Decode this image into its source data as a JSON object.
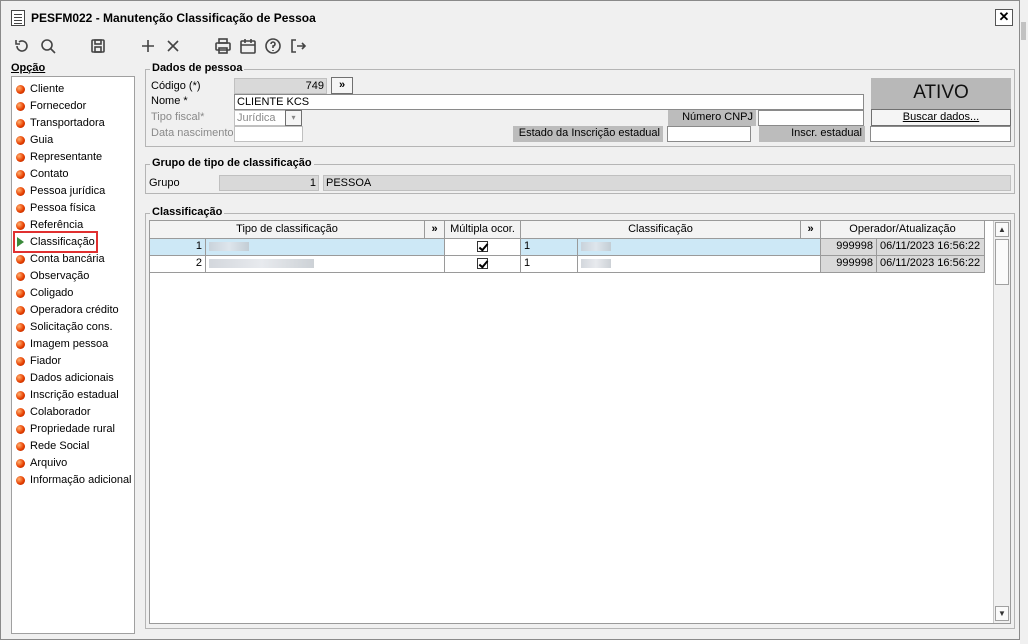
{
  "window": {
    "title": "PESFM022 - Manutenção Classificação de Pessoa",
    "close_label": "✕"
  },
  "toolbar": {
    "icons": [
      "undo-icon",
      "search-icon",
      "save-icon",
      "add-icon",
      "delete-icon",
      "print-icon",
      "calendar-icon",
      "help-icon",
      "exit-icon"
    ]
  },
  "sidebar": {
    "label": "Opção",
    "items": [
      {
        "label": "Cliente"
      },
      {
        "label": "Fornecedor"
      },
      {
        "label": "Transportadora"
      },
      {
        "label": "Guia"
      },
      {
        "label": "Representante"
      },
      {
        "label": "Contato"
      },
      {
        "label": "Pessoa jurídica"
      },
      {
        "label": "Pessoa física"
      },
      {
        "label": "Referência"
      },
      {
        "label": "Classificação"
      },
      {
        "label": "Conta bancária"
      },
      {
        "label": "Observação"
      },
      {
        "label": "Coligado"
      },
      {
        "label": "Operadora crédito"
      },
      {
        "label": "Solicitação cons."
      },
      {
        "label": "Imagem pessoa"
      },
      {
        "label": "Fiador"
      },
      {
        "label": "Dados adicionais"
      },
      {
        "label": "Inscrição estadual"
      },
      {
        "label": "Colaborador"
      },
      {
        "label": "Propriedade rural"
      },
      {
        "label": "Rede Social"
      },
      {
        "label": "Arquivo"
      },
      {
        "label": "Informação adicional"
      }
    ]
  },
  "dados": {
    "title": "Dados de pessoa",
    "codigo_label": "Código (*)",
    "codigo_value": "749",
    "more_label": "»",
    "nome_label": "Nome *",
    "nome_value": "CLIENTE  KCS",
    "tipo_fiscal_label": "Tipo fiscal*",
    "tipo_fiscal_value": "Jurídica",
    "data_nasc_label": "Data nascimento",
    "data_nasc_value": "",
    "numero_cnpj_label": "Número CNPJ",
    "numero_cnpj_value": "",
    "estado_ie_label": "Estado da Inscrição estadual",
    "estado_ie_value": "",
    "inscr_estadual_label": "Inscr. estadual",
    "inscr_estadual_value": "",
    "status": "ATIVO",
    "buscar_label": "Buscar dados..."
  },
  "grupo": {
    "title": "Grupo de tipo de classificação",
    "label": "Grupo",
    "code": "1",
    "name": "PESSOA"
  },
  "classificacao": {
    "title": "Classificação",
    "headers": {
      "tipo": "Tipo de classificação",
      "more1": "»",
      "multipla": "Múltipla ocor.",
      "classificacao": "Classificação",
      "more2": "»",
      "operador": "Operador/Atualização"
    },
    "rows": [
      {
        "code": "1",
        "multipla": true,
        "class_code": "1",
        "operador": "999998",
        "atualizacao": "06/11/2023 16:56:22"
      },
      {
        "code": "2",
        "multipla": true,
        "class_code": "1",
        "operador": "999998",
        "atualizacao": "06/11/2023 16:56:22"
      }
    ],
    "scroll_up": "▲",
    "scroll_down": "▼"
  }
}
